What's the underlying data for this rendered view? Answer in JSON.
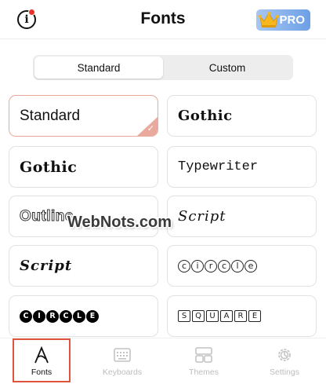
{
  "header": {
    "title": "Fonts",
    "info_icon": "info-icon",
    "pro_label": "PRO",
    "pro_icon": "crown-icon"
  },
  "segment": {
    "tabs": [
      "Standard",
      "Custom"
    ],
    "active": 0
  },
  "fonts": [
    {
      "label": "Standard",
      "style": "standard",
      "selected": true
    },
    {
      "label": "Gothic",
      "style": "gothic",
      "selected": false
    },
    {
      "label": "Gothic",
      "style": "gothic",
      "selected": false
    },
    {
      "label": "Typewriter",
      "style": "typewriter",
      "selected": false
    },
    {
      "label": "Outline",
      "style": "outline",
      "selected": false
    },
    {
      "label": "Script",
      "style": "script",
      "selected": false
    },
    {
      "label": "Script",
      "style": "script-bold",
      "selected": false
    },
    {
      "label": "circle",
      "style": "circled",
      "selected": false
    },
    {
      "label": "CIRCLE",
      "style": "circled-black",
      "selected": false
    },
    {
      "label": "SQUARE",
      "style": "squared",
      "selected": false
    }
  ],
  "watermark": "WebNots.com",
  "tabbar": {
    "tabs": [
      {
        "label": "Fonts",
        "icon": "fonts-icon",
        "active": true
      },
      {
        "label": "Keyboards",
        "icon": "keyboard-icon",
        "active": false
      },
      {
        "label": "Themes",
        "icon": "themes-icon",
        "active": false
      },
      {
        "label": "Settings",
        "icon": "settings-icon",
        "active": false
      }
    ]
  },
  "colors": {
    "selected_border": "#e9a99c",
    "highlight_box": "#e0533e",
    "pro_badge": "#6d9fe6",
    "notification_dot": "#e8332d"
  }
}
